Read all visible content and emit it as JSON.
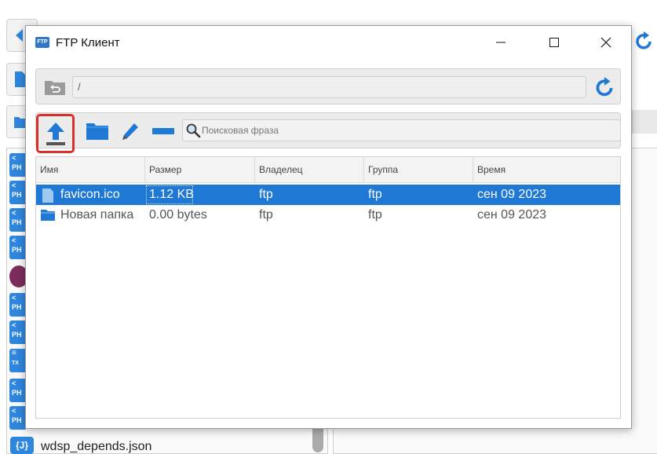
{
  "window": {
    "title": "FTP Клиент",
    "app_icon_text": "FTP",
    "minimize_symbol": "—",
    "maximize_symbol": "☐",
    "close_symbol": "✕"
  },
  "path_bar": {
    "current_path": "/",
    "back_icon": "folder-up-icon",
    "refresh_icon": "refresh-icon"
  },
  "actions": {
    "upload_icon": "upload-icon",
    "new_folder_icon": "folder-icon",
    "rename_icon": "pencil-icon",
    "delete_icon": "minus-icon"
  },
  "search": {
    "placeholder": "Поисковая фраза",
    "value": ""
  },
  "table": {
    "columns": [
      "Имя",
      "Размер",
      "Владелец",
      "Группа",
      "Время"
    ],
    "rows": [
      {
        "name": "favicon.ico",
        "size": "1.12 KB",
        "owner": "ftp",
        "group": "ftp",
        "time": "сен 09 2023",
        "type": "file",
        "selected": true
      },
      {
        "name": "Новая папка",
        "size": "0.00 bytes",
        "owner": "ftp",
        "group": "ftp",
        "time": "сен 09 2023",
        "type": "folder",
        "selected": false
      }
    ]
  },
  "background": {
    "icon_labels": [
      "<",
      "PH",
      "<",
      "PH",
      "<",
      "PH",
      "<",
      "PH",
      "<",
      "PH",
      "<",
      "PH",
      "TX",
      "<",
      "PH",
      "<",
      "PH"
    ],
    "json_icon": "{J}",
    "last_file": "wdsp_depends.json"
  },
  "colors": {
    "accent": "#1e78d4",
    "highlight_border": "#d9312a",
    "icon_blue": "#2e86de"
  }
}
